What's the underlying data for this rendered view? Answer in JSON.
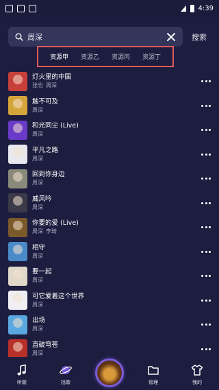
{
  "status": {
    "time": "4:39"
  },
  "search": {
    "value": "周深",
    "button_label": "搜索"
  },
  "tabs": [
    {
      "label": "资源甲",
      "active": true
    },
    {
      "label": "资源乙",
      "active": false
    },
    {
      "label": "资源丙",
      "active": false
    },
    {
      "label": "资源丁",
      "active": false
    }
  ],
  "songs": [
    {
      "title": "灯火里的中国",
      "artists": [
        "张也",
        "周深"
      ],
      "cover_color": "#c8403a"
    },
    {
      "title": "触不可及",
      "artists": [
        "周深"
      ],
      "cover_color": "#d4a53a"
    },
    {
      "title": "和光同尘 (Live)",
      "artists": [
        "周深"
      ],
      "cover_color": "#6a3ac8"
    },
    {
      "title": "平凡之路",
      "artists": [
        "周深"
      ],
      "cover_color": "#e8e8ee"
    },
    {
      "title": "回到你身边",
      "artists": [
        "周深"
      ],
      "cover_color": "#8a8a7a"
    },
    {
      "title": "威风吟",
      "artists": [
        "周深"
      ],
      "cover_color": "#3a3a48"
    },
    {
      "title": "你要的爱 (Live)",
      "artists": [
        "周深",
        "李琦"
      ],
      "cover_color": "#7a5a2a"
    },
    {
      "title": "相守",
      "artists": [
        "周深"
      ],
      "cover_color": "#4a8ac8"
    },
    {
      "title": "要一起",
      "artists": [
        "周深"
      ],
      "cover_color": "#e0d8c8"
    },
    {
      "title": "可它爱着这个世界",
      "artists": [
        "周深"
      ],
      "cover_color": "#f0f0f4"
    },
    {
      "title": "出场",
      "artists": [
        "周深"
      ],
      "cover_color": "#5aa8e0"
    },
    {
      "title": "直破穹苍",
      "artists": [
        "周深"
      ],
      "cover_color": "#b8302a"
    }
  ],
  "nav": [
    {
      "label": "听歌",
      "icon": "music-note-icon"
    },
    {
      "label": "找歌",
      "icon": "planet-icon"
    },
    {
      "label": "",
      "icon": "now-playing-disc"
    },
    {
      "label": "管理",
      "icon": "folder-icon"
    },
    {
      "label": "我的",
      "icon": "shirt-icon"
    }
  ]
}
